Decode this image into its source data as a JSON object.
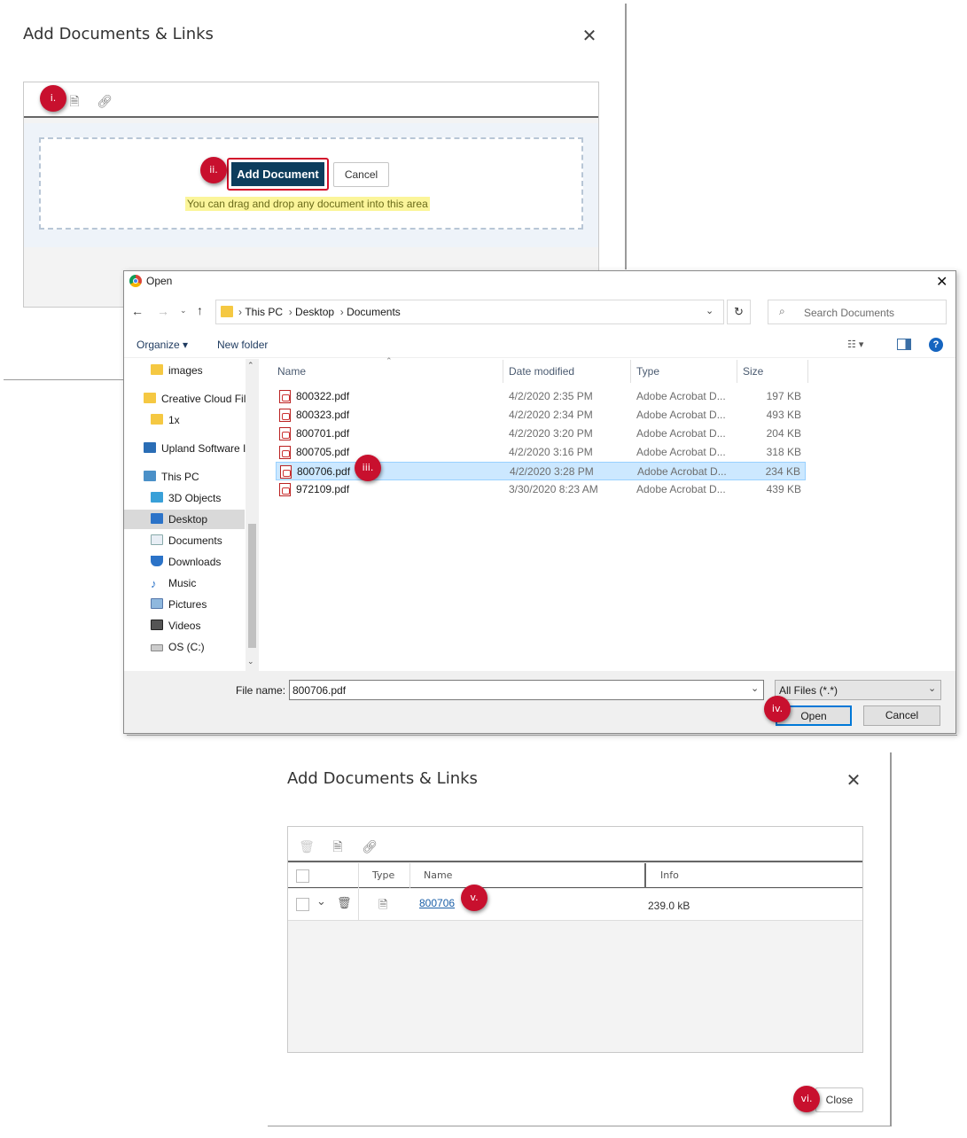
{
  "dialog1": {
    "title": "Add Documents & Links",
    "add_document_label": "Add Document",
    "cancel_label": "Cancel",
    "drop_hint": "You can drag and drop any document into this area"
  },
  "badges": {
    "b1": "i.",
    "b2": "ii.",
    "b3": "iii.",
    "b4": "iv.",
    "b5": "v.",
    "b6": "vi."
  },
  "open_dialog": {
    "title": "Open",
    "breadcrumb": [
      "This PC",
      "Desktop",
      "Documents"
    ],
    "search_placeholder": "Search Documents",
    "organize_label": "Organize ▾",
    "new_folder_label": "New folder",
    "nav": {
      "images": "images",
      "creative_cloud": "Creative Cloud Fil",
      "onex": "1x",
      "upland": "Upland Software I",
      "this_pc": "This PC",
      "objects3d": "3D Objects",
      "desktop": "Desktop",
      "documents": "Documents",
      "downloads": "Downloads",
      "music": "Music",
      "pictures": "Pictures",
      "videos": "Videos",
      "osc": "OS (C:)"
    },
    "columns": {
      "name": "Name",
      "date": "Date modified",
      "type": "Type",
      "size": "Size"
    },
    "files": [
      {
        "name": "800322.pdf",
        "date": "4/2/2020 2:35 PM",
        "type": "Adobe Acrobat D...",
        "size": "197 KB"
      },
      {
        "name": "800323.pdf",
        "date": "4/2/2020 2:34 PM",
        "type": "Adobe Acrobat D...",
        "size": "493 KB"
      },
      {
        "name": "800701.pdf",
        "date": "4/2/2020 3:20 PM",
        "type": "Adobe Acrobat D...",
        "size": "204 KB"
      },
      {
        "name": "800705.pdf",
        "date": "4/2/2020 3:16 PM",
        "type": "Adobe Acrobat D...",
        "size": "318 KB"
      },
      {
        "name": "800706.pdf",
        "date": "4/2/2020 3:28 PM",
        "type": "Adobe Acrobat D...",
        "size": "234 KB"
      },
      {
        "name": "972109.pdf",
        "date": "3/30/2020 8:23 AM",
        "type": "Adobe Acrobat D...",
        "size": "439 KB"
      }
    ],
    "file_name_label": "File name:",
    "file_name_value": "800706.pdf",
    "filter_value": "All Files (*.*)",
    "open_label": "Open",
    "cancel_label": "Cancel"
  },
  "dialog2": {
    "title": "Add Documents & Links",
    "col_type": "Type",
    "col_name": "Name",
    "col_info": "Info",
    "row_name": "800706",
    "row_info": "239.0 kB",
    "close_label": "Close"
  },
  "colors": {
    "badge": "#c8102e",
    "add_button": "#0d3d5c",
    "selection": "#cce8ff",
    "link": "#1a5fa8"
  }
}
